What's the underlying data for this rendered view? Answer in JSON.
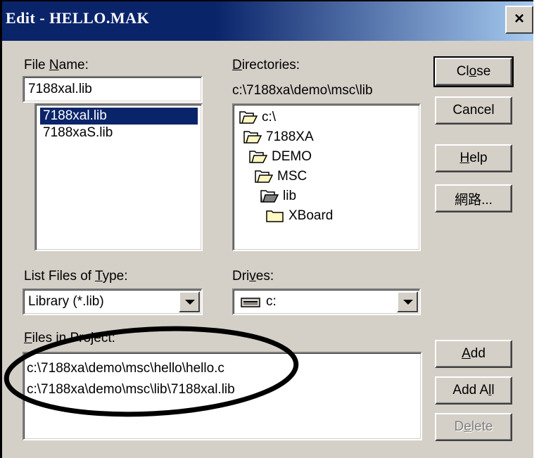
{
  "window": {
    "title": "Edit - HELLO.MAK",
    "close_glyph": "×"
  },
  "labels": {
    "file_name_pre": "File ",
    "file_name_key": "N",
    "file_name_post": "ame:",
    "directories_key": "D",
    "directories_post": "irectories:",
    "current_dir": "c:\\7188xa\\demo\\msc\\lib",
    "list_type_pre": "List Files of ",
    "list_type_key": "T",
    "list_type_post": "ype:",
    "drives_pre": "Dri",
    "drives_key": "v",
    "drives_post": "es:",
    "files_in_project_key": "F",
    "files_in_project_post": "iles in Project:"
  },
  "file_name_value": "7188xal.lib",
  "file_list": [
    "7188xal.lib",
    "7188xaS.lib"
  ],
  "directory_tree": [
    {
      "label": "c:\\",
      "icon": "open-folder-icon"
    },
    {
      "label": "7188XA",
      "icon": "open-folder-icon"
    },
    {
      "label": "DEMO",
      "icon": "open-folder-icon"
    },
    {
      "label": "MSC",
      "icon": "open-folder-icon"
    },
    {
      "label": "lib",
      "icon": "open-folder-icon"
    },
    {
      "label": "XBoard",
      "icon": "folder-icon"
    }
  ],
  "file_type_value": "Library (*.lib)",
  "drive_value": "c:",
  "project_files": [
    "c:\\7188xa\\demo\\msc\\hello\\hello.c",
    "c:\\7188xa\\demo\\msc\\lib\\7188xal.lib"
  ],
  "buttons": {
    "close_pre": "Cl",
    "close_key": "o",
    "close_post": "se",
    "cancel": "Cancel",
    "help_key": "H",
    "help_post": "elp",
    "network": "網路...",
    "add_key": "A",
    "add_post": "dd",
    "add_all_pre": "Add A",
    "add_all_key": "l",
    "add_all_post": "l",
    "delete_pre": "D",
    "delete_key": "e",
    "delete_post": "lete"
  },
  "colors": {
    "title_bar": "#0a246a",
    "selection": "#0a246a",
    "annotation": "#000000"
  }
}
